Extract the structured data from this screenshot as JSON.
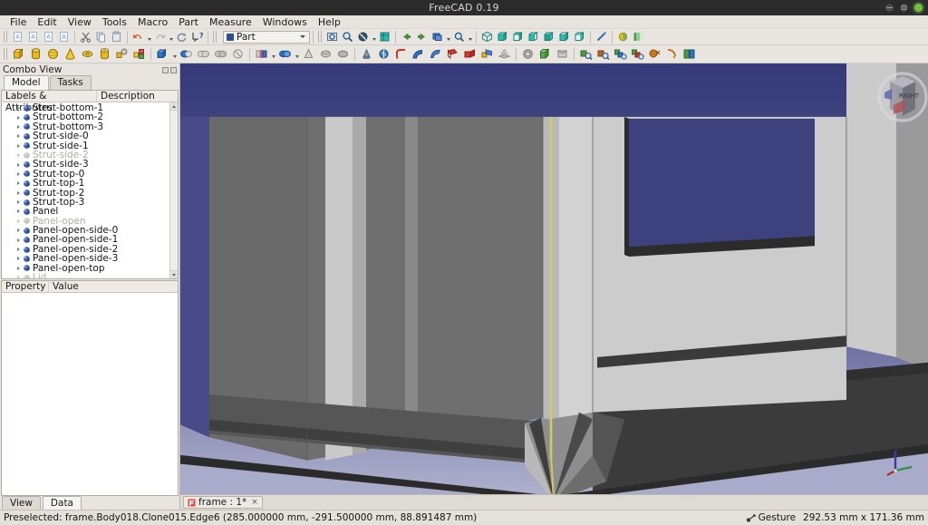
{
  "window": {
    "title": "FreeCAD 0.19",
    "controls": [
      "minimize",
      "maximize",
      "close"
    ]
  },
  "menubar": {
    "items": [
      "File",
      "Edit",
      "View",
      "Tools",
      "Macro",
      "Part",
      "Measure",
      "Windows",
      "Help"
    ]
  },
  "toolbars": {
    "row1": {
      "file_group": [
        "new-document-icon",
        "open-document-icon",
        "save-document-icon",
        "print-icon"
      ],
      "edit_group": [
        "cut-icon",
        "copy-icon",
        "paste-icon"
      ],
      "history_group": [
        "undo-icon",
        "redo-icon",
        "refresh-icon",
        "whats-this-icon"
      ],
      "workbench": {
        "label": "Part",
        "icon": "workbench-icon"
      },
      "view_group": [
        "fit-all-icon",
        "fit-selection-icon",
        "draw-style-icon",
        "toggle-axis-cross-icon",
        "view-previous-icon",
        "view-next-icon",
        "box-zoom-icon",
        "box-selection-icon",
        "isometric-view-icon",
        "front-view-icon",
        "top-view-icon",
        "right-view-icon",
        "rear-view-icon",
        "bottom-view-icon",
        "left-view-icon",
        "measure-icon",
        "appearance-icon",
        "random-color-icon"
      ]
    },
    "row2": {
      "primitives": [
        "box-icon",
        "cylinder-icon",
        "sphere-icon",
        "cone-icon",
        "torus-icon",
        "tube-icon",
        "shape-builder-icon",
        "primitives-icon"
      ],
      "booleans": [
        "boolean-icon",
        "cut-boolean-icon",
        "union-icon",
        "common-icon",
        "intersect-icon",
        "join-icon",
        "connect-icon",
        "embed-icon",
        "cutout-icon"
      ],
      "modify": [
        "extrude-icon",
        "revolve-icon",
        "mirror-icon",
        "fillet-icon",
        "chamfer-icon",
        "ruled-surface-icon",
        "loft-icon",
        "sweep-icon",
        "section-icon",
        "cross-sections-icon",
        "offset-3d-icon",
        "thickness-icon",
        "projection-on-surface-icon",
        "check-geometry-icon",
        "defeaturing-icon",
        "boolean-fragments-icon",
        "slice-apart-icon",
        "xor-icon",
        "compound-filter-icon",
        "explode-compound-icon",
        "compound-tools-icon"
      ]
    }
  },
  "combo_view": {
    "title": "Combo View",
    "dock_buttons": [
      "float-button",
      "close-button"
    ],
    "tabs": [
      {
        "label": "Model",
        "active": true
      },
      {
        "label": "Tasks",
        "active": false
      }
    ],
    "tree": {
      "columns": [
        "Labels & Attributes",
        "Description"
      ],
      "items": [
        {
          "label": "Strut-bottom-1",
          "dim": false
        },
        {
          "label": "Strut-bottom-2",
          "dim": false
        },
        {
          "label": "Strut-bottom-3",
          "dim": false
        },
        {
          "label": "Strut-side-0",
          "dim": false
        },
        {
          "label": "Strut-side-1",
          "dim": false
        },
        {
          "label": "Strut-side-2",
          "dim": true
        },
        {
          "label": "Strut-side-3",
          "dim": false
        },
        {
          "label": "Strut-top-0",
          "dim": false
        },
        {
          "label": "Strut-top-1",
          "dim": false
        },
        {
          "label": "Strut-top-2",
          "dim": false
        },
        {
          "label": "Strut-top-3",
          "dim": false
        },
        {
          "label": "Panel",
          "dim": false
        },
        {
          "label": "Panel-open",
          "dim": true
        },
        {
          "label": "Panel-open-side-0",
          "dim": false
        },
        {
          "label": "Panel-open-side-1",
          "dim": false
        },
        {
          "label": "Panel-open-side-2",
          "dim": false
        },
        {
          "label": "Panel-open-side-3",
          "dim": false
        },
        {
          "label": "Panel-open-top",
          "dim": false
        },
        {
          "label": "Lid",
          "dim": true
        }
      ]
    },
    "properties": {
      "columns": [
        "Property",
        "Value"
      ],
      "rows": []
    },
    "bottom_tabs": [
      {
        "label": "View",
        "active": false
      },
      {
        "label": "Data",
        "active": true
      }
    ]
  },
  "document_bar": {
    "tabs": [
      {
        "label": "frame : 1*",
        "close": "×",
        "icon": "freecad-document-icon"
      }
    ]
  },
  "viewport": {
    "navigation_cube": "navigation-cube",
    "cube_face_label": "RIGHT",
    "axis_cross": "axis-cross-indicator",
    "background_top": "#3b3f7d",
    "background_bottom": "#a9abcb",
    "model_light": "#cfcfcf",
    "model_mid": "#7f7f7f",
    "model_dark": "#3c3c3c",
    "highlight_edge": "#c8cf62"
  },
  "statusbar": {
    "message": "Preselected: frame.Body018.Clone015.Edge6 (285.000000 mm, -291.500000 mm, 88.891487 mm)",
    "navigation_mode": "Gesture",
    "dimensions": "292.53 mm x 171.36 mm",
    "nav_icon": "gesture-icon"
  }
}
